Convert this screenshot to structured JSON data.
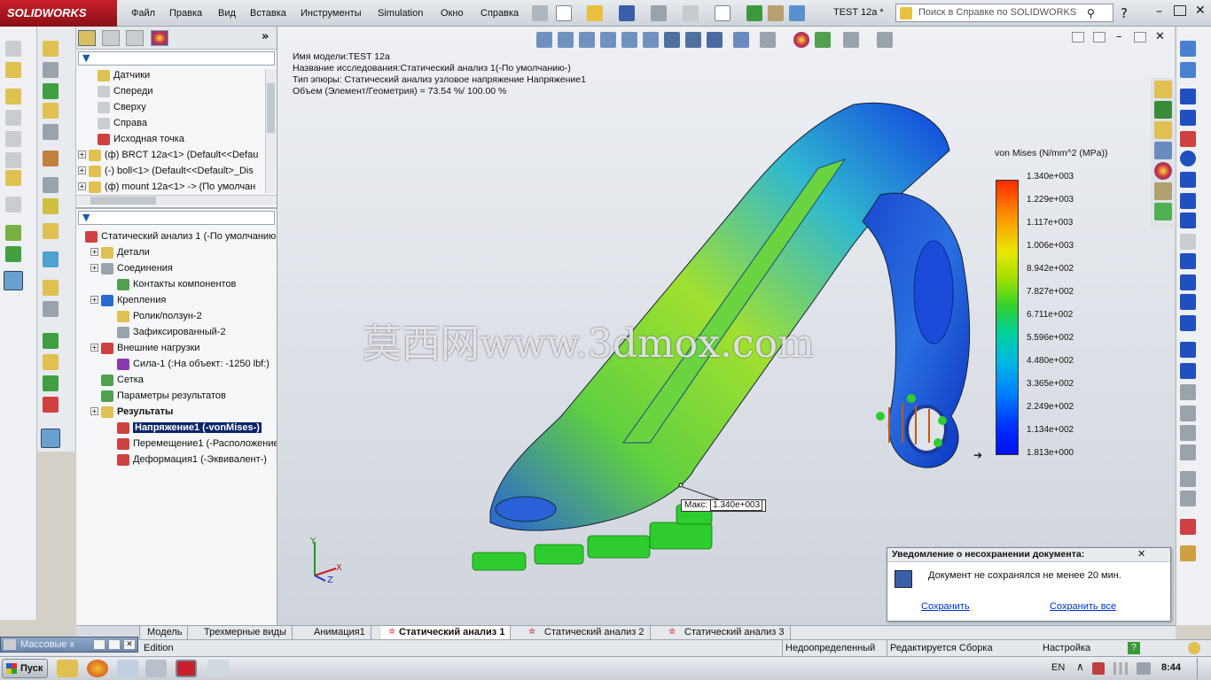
{
  "app": {
    "logo_text": "SOLIDWORKS",
    "doc_title": "TEST 12a *",
    "help_search_placeholder": "Поиск в Справке по SOLIDWORKS"
  },
  "menu": [
    "Файл",
    "Правка",
    "Вид",
    "Вставка",
    "Инструменты",
    "Simulation",
    "Окно",
    "Справка"
  ],
  "tree_top": [
    {
      "label": "Датчики",
      "icon": "sensors-icon"
    },
    {
      "label": "Спереди",
      "icon": "plane-icon"
    },
    {
      "label": "Сверху",
      "icon": "plane-icon"
    },
    {
      "label": "Справа",
      "icon": "plane-icon"
    },
    {
      "label": "Исходная точка",
      "icon": "origin-icon"
    },
    {
      "label": "(ф) BRCT 12a<1> (Default<<Defau",
      "icon": "part-icon"
    },
    {
      "label": "(-) boll<1> (Default<<Default>_Dis",
      "icon": "part-icon"
    },
    {
      "label": "(ф) mount 12a<1> -> (По умолчан",
      "icon": "part-icon"
    }
  ],
  "tree_study": [
    {
      "label": "Статический анализ 1 (-По умолчанию",
      "icon": "study-icon",
      "indent": 0
    },
    {
      "label": "Детали",
      "icon": "parts-icon",
      "indent": 1
    },
    {
      "label": "Соединения",
      "icon": "connections-icon",
      "indent": 1
    },
    {
      "label": "Контакты компонентов",
      "icon": "contacts-icon",
      "indent": 2
    },
    {
      "label": "Крепления",
      "icon": "fixtures-icon",
      "indent": 1
    },
    {
      "label": "Ролик/ползун-2",
      "icon": "roller-icon",
      "indent": 2
    },
    {
      "label": "Зафиксированный-2",
      "icon": "fixed-icon",
      "indent": 2
    },
    {
      "label": "Внешние нагрузки",
      "icon": "loads-icon",
      "indent": 1
    },
    {
      "label": "Сила-1 (:На объект: -1250 lbf:)",
      "icon": "force-icon",
      "indent": 2
    },
    {
      "label": "Сетка",
      "icon": "mesh-icon",
      "indent": 1
    },
    {
      "label": "Параметры результатов",
      "icon": "result-options-icon",
      "indent": 1
    },
    {
      "label": "Результаты",
      "icon": "results-folder-icon",
      "indent": 1
    },
    {
      "label": "Напряжение1 (-vonMises-)",
      "icon": "stress-icon",
      "indent": 2,
      "selected": true
    },
    {
      "label": "Перемещение1 (-Расположение",
      "icon": "displacement-icon",
      "indent": 2
    },
    {
      "label": "Деформация1 (-Эквивалент-)",
      "icon": "strain-icon",
      "indent": 2
    }
  ],
  "plot_info": [
    "Имя модели:TEST 12a",
    "Название исследования:Статический анализ 1(-По умолчанию-)",
    "Тип эпюры: Статический анализ узловое напряжение Напряжение1",
    "Объем (Элемент/Геометрия) = 73.54 %/ 100.00 %"
  ],
  "legend": {
    "title": "von Mises (N/mm^2 (MPa))",
    "values": [
      "1.340e+003",
      "1.229e+003",
      "1.117e+003",
      "1.006e+003",
      "8.942e+002",
      "7.827e+002",
      "6.711e+002",
      "5.596e+002",
      "4.480e+002",
      "3.365e+002",
      "2.249e+002",
      "1.134e+002",
      "1.813e+000"
    ]
  },
  "max_label": {
    "prefix": "Макс:",
    "value": "1.340e+003"
  },
  "watermark": "莫西网www.3dmox.com",
  "triad": {
    "x": "X",
    "y": "Y",
    "z": "Z"
  },
  "tabs": [
    "Модель",
    "Трехмерные виды",
    "Анимация1",
    "Статический анализ 1",
    "Статический анализ 2",
    "Статический анализ 3"
  ],
  "active_tab": "Статический анализ 1",
  "floating_panel": "Массовые х",
  "status": {
    "left": "Edition",
    "state": "Недоопределенный",
    "mode": "Редактируется Сборка",
    "custom": "Настройка"
  },
  "notification": {
    "title": "Уведомление о несохранении документа:",
    "message": "Документ не сохранялся не менее 20 мин.",
    "save": "Сохранить",
    "save_all": "Сохранить все"
  },
  "taskbar": {
    "start": "Пуск",
    "lang": "EN",
    "time": "8:44"
  },
  "colors": {
    "accent_red": "#c8202a",
    "select_blue": "#0a246a",
    "link": "#0033cc"
  }
}
